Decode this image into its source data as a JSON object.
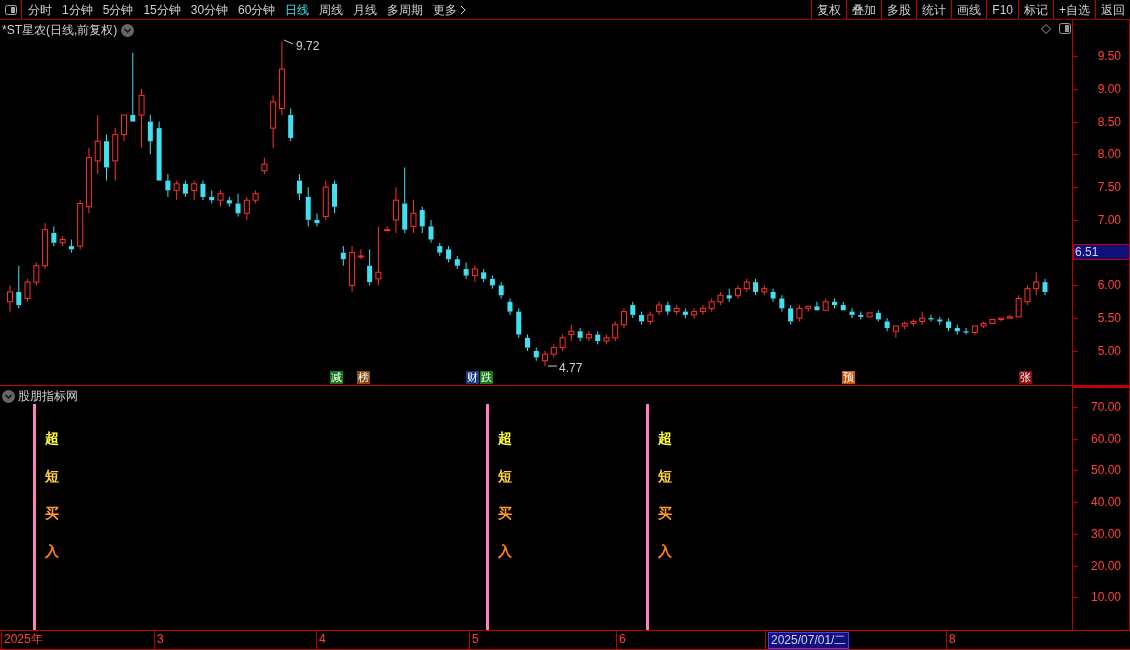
{
  "toolbar": {
    "periods": [
      {
        "label": "分时",
        "selected": false
      },
      {
        "label": "1分钟",
        "selected": false
      },
      {
        "label": "5分钟",
        "selected": false
      },
      {
        "label": "15分钟",
        "selected": false
      },
      {
        "label": "30分钟",
        "selected": false
      },
      {
        "label": "60分钟",
        "selected": false
      },
      {
        "label": "日线",
        "selected": true
      },
      {
        "label": "周线",
        "selected": false
      },
      {
        "label": "月线",
        "selected": false
      },
      {
        "label": "多周期",
        "selected": false
      },
      {
        "label": "更多",
        "selected": false
      }
    ],
    "buttons": [
      "复权",
      "叠加",
      "多股",
      "统计",
      "画线",
      "F10",
      "标记",
      "+自选",
      "返回"
    ]
  },
  "header": {
    "title": "*ST星农(日线,前复权)"
  },
  "price_chart": {
    "chart_data": {
      "type": "candlestick",
      "ylim": [
        4.48,
        10.05
      ],
      "yticks": [
        {
          "value": 9.5,
          "label": "9.50"
        },
        {
          "value": 9,
          "label": "9.00"
        },
        {
          "value": 8.5,
          "label": "8.50"
        },
        {
          "value": 8,
          "label": "8.00"
        },
        {
          "value": 7.5,
          "label": "7.50"
        },
        {
          "value": 7,
          "label": "7.00"
        },
        {
          "value": 6,
          "label": "6.00"
        },
        {
          "value": 5.5,
          "label": "5.50"
        },
        {
          "value": 5,
          "label": "5.00"
        }
      ],
      "ohlc": [
        [
          5.75,
          6.0,
          5.6,
          5.9
        ],
        [
          5.9,
          6.3,
          5.65,
          5.7
        ],
        [
          5.8,
          6.1,
          5.75,
          6.05
        ],
        [
          6.05,
          6.35,
          6.0,
          6.3
        ],
        [
          6.3,
          6.95,
          6.25,
          6.85
        ],
        [
          6.8,
          6.9,
          6.6,
          6.65
        ],
        [
          6.65,
          6.75,
          6.6,
          6.7
        ],
        [
          6.6,
          6.7,
          6.5,
          6.55
        ],
        [
          6.6,
          7.3,
          6.55,
          7.25
        ],
        [
          7.2,
          8.1,
          7.1,
          7.95
        ],
        [
          7.9,
          8.6,
          7.7,
          8.2
        ],
        [
          8.2,
          8.3,
          7.6,
          7.8
        ],
        [
          7.9,
          8.4,
          7.6,
          8.3
        ],
        [
          8.3,
          8.6,
          8.2,
          8.6
        ],
        [
          8.6,
          9.55,
          8.5,
          8.5
        ],
        [
          8.6,
          9.0,
          8.1,
          8.9
        ],
        [
          8.5,
          8.6,
          8.0,
          8.2
        ],
        [
          8.4,
          8.5,
          7.6,
          7.6
        ],
        [
          7.6,
          7.7,
          7.35,
          7.45
        ],
        [
          7.45,
          7.6,
          7.3,
          7.55
        ],
        [
          7.55,
          7.6,
          7.35,
          7.4
        ],
        [
          7.45,
          7.6,
          7.3,
          7.55
        ],
        [
          7.55,
          7.6,
          7.3,
          7.35
        ],
        [
          7.35,
          7.45,
          7.25,
          7.3
        ],
        [
          7.3,
          7.45,
          7.2,
          7.4
        ],
        [
          7.3,
          7.35,
          7.2,
          7.25
        ],
        [
          7.25,
          7.4,
          7.05,
          7.1
        ],
        [
          7.1,
          7.35,
          7.0,
          7.3
        ],
        [
          7.3,
          7.45,
          7.25,
          7.4
        ],
        [
          7.75,
          7.95,
          7.7,
          7.85
        ],
        [
          8.4,
          8.9,
          8.1,
          8.8
        ],
        [
          8.7,
          9.72,
          8.6,
          9.3
        ],
        [
          8.6,
          8.7,
          8.2,
          8.25
        ],
        [
          7.6,
          7.7,
          7.3,
          7.4
        ],
        [
          7.35,
          7.5,
          6.9,
          7.0
        ],
        [
          7.0,
          7.1,
          6.9,
          6.95
        ],
        [
          7.05,
          7.6,
          7.0,
          7.5
        ],
        [
          7.55,
          7.6,
          7.1,
          7.2
        ],
        [
          6.5,
          6.6,
          6.3,
          6.4
        ],
        [
          6.0,
          6.6,
          5.9,
          6.5
        ],
        [
          6.45,
          6.55,
          6.4,
          6.45
        ],
        [
          6.3,
          6.55,
          6.0,
          6.05
        ],
        [
          6.1,
          6.9,
          6.0,
          6.2
        ],
        [
          6.85,
          6.9,
          6.85,
          6.85
        ],
        [
          7.0,
          7.5,
          6.8,
          7.3
        ],
        [
          7.25,
          7.8,
          6.8,
          6.85
        ],
        [
          6.9,
          7.3,
          6.8,
          7.1
        ],
        [
          7.15,
          7.2,
          6.8,
          6.9
        ],
        [
          6.9,
          7.0,
          6.65,
          6.7
        ],
        [
          6.6,
          6.65,
          6.45,
          6.5
        ],
        [
          6.55,
          6.6,
          6.35,
          6.4
        ],
        [
          6.4,
          6.45,
          6.25,
          6.3
        ],
        [
          6.25,
          6.35,
          6.1,
          6.15
        ],
        [
          6.15,
          6.3,
          6.05,
          6.25
        ],
        [
          6.2,
          6.25,
          6.05,
          6.1
        ],
        [
          6.1,
          6.15,
          5.95,
          6.0
        ],
        [
          6.0,
          6.05,
          5.8,
          5.85
        ],
        [
          5.75,
          5.8,
          5.55,
          5.6
        ],
        [
          5.6,
          5.65,
          5.2,
          5.25
        ],
        [
          5.2,
          5.25,
          5.0,
          5.05
        ],
        [
          5.0,
          5.05,
          4.85,
          4.9
        ],
        [
          4.85,
          5.0,
          4.77,
          4.95
        ],
        [
          4.95,
          5.1,
          4.9,
          5.05
        ],
        [
          5.05,
          5.25,
          5.0,
          5.2
        ],
        [
          5.25,
          5.4,
          5.15,
          5.3
        ],
        [
          5.3,
          5.35,
          5.15,
          5.2
        ],
        [
          5.2,
          5.3,
          5.15,
          5.25
        ],
        [
          5.25,
          5.3,
          5.1,
          5.15
        ],
        [
          5.15,
          5.25,
          5.1,
          5.2
        ],
        [
          5.2,
          5.45,
          5.15,
          5.4
        ],
        [
          5.4,
          5.65,
          5.35,
          5.6
        ],
        [
          5.7,
          5.75,
          5.5,
          5.55
        ],
        [
          5.55,
          5.6,
          5.4,
          5.45
        ],
        [
          5.45,
          5.6,
          5.4,
          5.55
        ],
        [
          5.6,
          5.75,
          5.55,
          5.7
        ],
        [
          5.7,
          5.75,
          5.55,
          5.6
        ],
        [
          5.6,
          5.7,
          5.55,
          5.65
        ],
        [
          5.6,
          5.65,
          5.5,
          5.55
        ],
        [
          5.55,
          5.65,
          5.5,
          5.6
        ],
        [
          5.6,
          5.7,
          5.55,
          5.65
        ],
        [
          5.65,
          5.8,
          5.6,
          5.75
        ],
        [
          5.75,
          5.9,
          5.7,
          5.85
        ],
        [
          5.85,
          5.95,
          5.75,
          5.8
        ],
        [
          5.85,
          6.0,
          5.8,
          5.95
        ],
        [
          5.95,
          6.1,
          5.9,
          6.05
        ],
        [
          6.05,
          6.1,
          5.85,
          5.9
        ],
        [
          5.9,
          6.0,
          5.85,
          5.95
        ],
        [
          5.9,
          5.95,
          5.75,
          5.8
        ],
        [
          5.8,
          5.85,
          5.6,
          5.65
        ],
        [
          5.65,
          5.7,
          5.4,
          5.45
        ],
        [
          5.5,
          5.7,
          5.45,
          5.65
        ],
        [
          5.65,
          5.7,
          5.6,
          5.68
        ],
        [
          5.68,
          5.75,
          5.6,
          5.62
        ],
        [
          5.62,
          5.8,
          5.6,
          5.75
        ],
        [
          5.75,
          5.8,
          5.65,
          5.7
        ],
        [
          5.7,
          5.75,
          5.6,
          5.62
        ],
        [
          5.6,
          5.65,
          5.5,
          5.55
        ],
        [
          5.55,
          5.6,
          5.48,
          5.52
        ],
        [
          5.52,
          5.6,
          5.5,
          5.58
        ],
        [
          5.58,
          5.62,
          5.45,
          5.48
        ],
        [
          5.45,
          5.5,
          5.3,
          5.35
        ],
        [
          5.3,
          5.4,
          5.2,
          5.38
        ],
        [
          5.38,
          5.45,
          5.33,
          5.42
        ],
        [
          5.42,
          5.48,
          5.38,
          5.45
        ],
        [
          5.45,
          5.6,
          5.4,
          5.5
        ],
        [
          5.5,
          5.55,
          5.45,
          5.48
        ],
        [
          5.48,
          5.52,
          5.4,
          5.45
        ],
        [
          5.45,
          5.5,
          5.3,
          5.35
        ],
        [
          5.35,
          5.4,
          5.25,
          5.3
        ],
        [
          5.3,
          5.35,
          5.25,
          5.28
        ],
        [
          5.28,
          5.4,
          5.25,
          5.38
        ],
        [
          5.38,
          5.45,
          5.35,
          5.42
        ],
        [
          5.42,
          5.5,
          5.4,
          5.48
        ],
        [
          5.48,
          5.52,
          5.45,
          5.5
        ],
        [
          5.5,
          5.55,
          5.48,
          5.52
        ],
        [
          5.52,
          5.85,
          5.5,
          5.8
        ],
        [
          5.75,
          6.0,
          5.7,
          5.95
        ],
        [
          5.95,
          6.2,
          5.85,
          6.05
        ],
        [
          6.05,
          6.1,
          5.85,
          5.9
        ]
      ]
    }
  },
  "price_axis": {
    "current_price": "6.51"
  },
  "annotations": {
    "high": "9.72",
    "low": "4.77"
  },
  "event_tags": [
    {
      "text": "减",
      "color": "#157a15"
    },
    {
      "text": "榜",
      "color": "#8a4a10"
    },
    {
      "text": "财",
      "color": "#1a3a80"
    },
    {
      "text": "跌",
      "color": "#157a15"
    },
    {
      "text": "预",
      "color": "#c05a10"
    },
    {
      "text": "张",
      "color": "#8a1010"
    }
  ],
  "indicator": {
    "title": "股朋指标网",
    "axis": [
      "70.00",
      "60.00",
      "50.00",
      "40.00",
      "30.00",
      "20.00",
      "10.00"
    ],
    "signals": [
      {
        "chars": [
          {
            "text": "超",
            "color": "#ffff40"
          },
          {
            "text": "短",
            "color": "#ffd040"
          },
          {
            "text": "买",
            "color": "#ff9a30"
          },
          {
            "text": "入",
            "color": "#ff8020"
          }
        ]
      },
      {
        "chars": [
          {
            "text": "超",
            "color": "#ffff40"
          },
          {
            "text": "短",
            "color": "#ffd040"
          },
          {
            "text": "买",
            "color": "#ff9a30"
          },
          {
            "text": "入",
            "color": "#ff8020"
          }
        ]
      },
      {
        "chars": [
          {
            "text": "超",
            "color": "#ffff40"
          },
          {
            "text": "短",
            "color": "#ffd040"
          },
          {
            "text": "买",
            "color": "#ff9a30"
          },
          {
            "text": "入",
            "color": "#ff8020"
          }
        ]
      }
    ]
  },
  "date_axis": [
    {
      "label": "2025年",
      "selected": false
    },
    {
      "label": "3",
      "selected": false
    },
    {
      "label": "4",
      "selected": false
    },
    {
      "label": "5",
      "selected": false
    },
    {
      "label": "6",
      "selected": false
    },
    {
      "label": "2025/07/01/二",
      "selected": true
    },
    {
      "label": "8",
      "selected": false
    }
  ]
}
